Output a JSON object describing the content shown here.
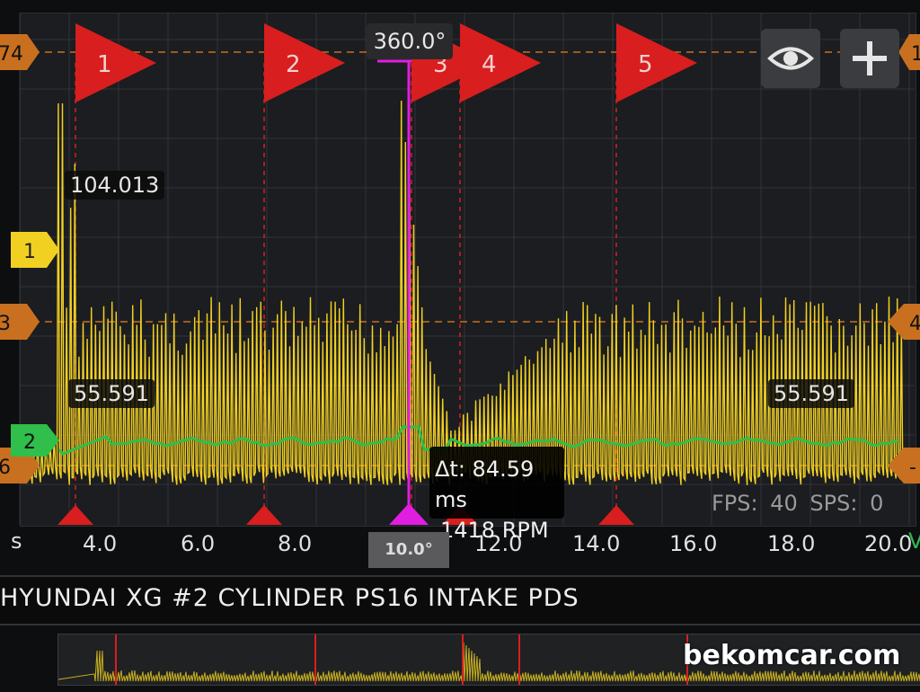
{
  "app": {
    "title": "HYUNDAI XG #2 CYLINDER PS16 INTAKE PDS",
    "watermark": "bekomcar.com"
  },
  "toolbar": {
    "eye_button": "eye-icon",
    "add_button": "plus-icon"
  },
  "scope": {
    "angle_readout": "360.0°",
    "cursor_badge": "10.0°",
    "delta_time": "Δt: 84.59 ms",
    "rpm": "1418 RPM",
    "fps": "FPS: 40",
    "sps": "SPS: 0",
    "x_unit": "s",
    "y2_unit": "V",
    "readouts": [
      "104.013",
      "55.591",
      "55.591"
    ],
    "left_markers": [
      "74",
      "3",
      "6"
    ],
    "right_markers": [
      "1",
      "4",
      "-"
    ],
    "channel_markers": [
      "1",
      "2"
    ],
    "flags": [
      "1",
      "2",
      "3",
      "4",
      "5"
    ],
    "x_ticks": [
      "4.0",
      "6.0",
      "8.0",
      "10.0",
      "12.0",
      "14.0",
      "16.0",
      "18.0",
      "20.0"
    ],
    "colors": {
      "trace1": "#f2d022",
      "trace2": "#2fbf4a",
      "flag": "#d81e1e",
      "cursor": "#e01ee0",
      "ref_line": "#c87020"
    }
  }
}
